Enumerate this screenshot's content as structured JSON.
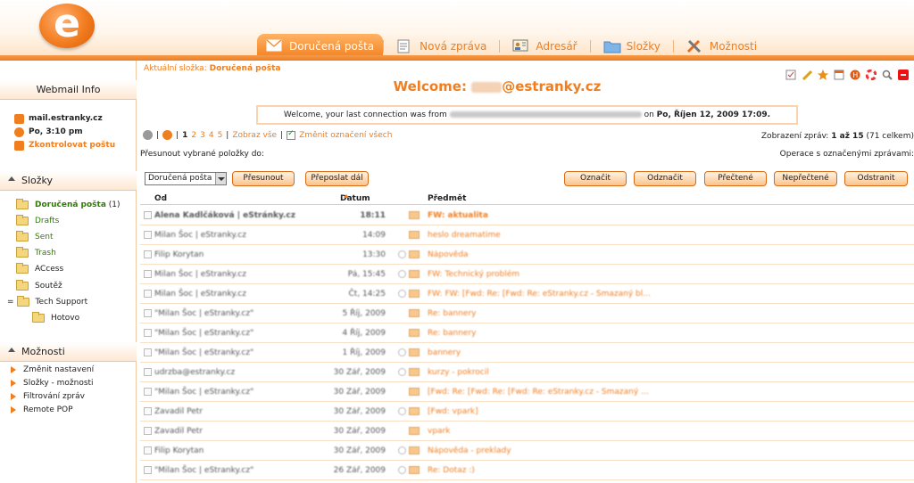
{
  "header": {
    "tabs": [
      {
        "label": "Doručená pošta",
        "icon": "envelope-icon",
        "active": true
      },
      {
        "label": "Nová zpráva",
        "icon": "compose-icon",
        "active": false
      },
      {
        "label": "Adresář",
        "icon": "addressbook-icon",
        "active": false
      },
      {
        "label": "Složky",
        "icon": "folder-icon",
        "active": false
      },
      {
        "label": "Možnosti",
        "icon": "tools-icon",
        "active": false
      }
    ]
  },
  "sidebar": {
    "info_title": "Webmail Info",
    "server": "mail.estranky.cz",
    "datetime": "Po, 3:10 pm",
    "check_mail": "Zkontrolovat poštu",
    "folders_title": "Složky",
    "folders": [
      {
        "label": "Doručená pošta",
        "count": "(1)"
      },
      {
        "label": "Drafts"
      },
      {
        "label": "Sent"
      },
      {
        "label": "Trash"
      },
      {
        "label": "ACcess"
      },
      {
        "label": "Soutěž"
      },
      {
        "label": "Tech Support",
        "toggle": "="
      },
      {
        "label": "Hotovo"
      }
    ],
    "options_title": "Možnosti",
    "options": [
      "Změnit nastavení",
      "Složky - možnosti",
      "Filtrování zpráv",
      "Remote POP"
    ]
  },
  "main": {
    "breadcrumb_label": "Aktuální složka:",
    "breadcrumb_folder": "Doručená pošta",
    "welcome_prefix": "Welcome:",
    "welcome_domain": "@estranky.cz",
    "lastconn_prefix": "Welcome, your last connection was from",
    "lastconn_on": "on",
    "lastconn_date": "Po, Říjen 12, 2009 17:09.",
    "pager_sep": "|",
    "pages": [
      "1",
      "2",
      "3",
      "4",
      "5"
    ],
    "show_all": "Zobraz vše",
    "toggle_all": "Změnit označení všech",
    "show_info_prefix": "Zobrazení zpráv:",
    "show_info_range": "1 až 15",
    "show_info_total": "(71 celkem)",
    "move_label": "Přesunout vybrané položky do:",
    "ops_label": "Operace s označenými zprávami:",
    "select_value": "Doručená pošta",
    "buttons": {
      "move": "Přesunout",
      "forward": "Přeposlat dál",
      "mark": "Označit",
      "unmark": "Odznačit",
      "read": "Přečtené",
      "unread": "Nepřečtené",
      "delete": "Odstranit"
    },
    "columns": {
      "from": "Od",
      "date": "Datum",
      "subject": "Předmět"
    },
    "rows": [
      {
        "from": "Alena Kadlčáková | eStránky.cz",
        "date": "18:11",
        "subject": "FW: aktualita",
        "bold": true,
        "attach": false
      },
      {
        "from": "Milan Šoc | eStranky.cz",
        "date": "14:09",
        "subject": "heslo dreamatime",
        "bold": false,
        "attach": false
      },
      {
        "from": "Filip Korytan",
        "date": "13:30",
        "subject": "Nápověda",
        "bold": false,
        "attach": true
      },
      {
        "from": "Milan Šoc | eStranky.cz",
        "date": "Pá, 15:45",
        "subject": "FW: Technický problém",
        "bold": false,
        "attach": true
      },
      {
        "from": "Milan Šoc | eStranky.cz",
        "date": "Čt, 14:25",
        "subject": "FW: FW: [Fwd: Re: [Fwd: Re: eStranky.cz - Smazaný bl...",
        "bold": false,
        "attach": true
      },
      {
        "from": "\"Milan Šoc | eStranky.cz\"",
        "date": "5 Říj, 2009",
        "subject": "Re: bannery",
        "bold": false,
        "attach": false
      },
      {
        "from": "\"Milan Šoc | eStranky.cz\"",
        "date": "4 Říj, 2009",
        "subject": "Re: bannery",
        "bold": false,
        "attach": false
      },
      {
        "from": "\"Milan Šoc | eStranky.cz\"",
        "date": "1 Říj, 2009",
        "subject": "bannery",
        "bold": false,
        "attach": true
      },
      {
        "from": "udrzba@estranky.cz",
        "date": "30 Zář, 2009",
        "subject": "kurzy - pokrocil",
        "bold": false,
        "attach": true
      },
      {
        "from": "\"Milan Šoc | eStranky.cz\"",
        "date": "30 Zář, 2009",
        "subject": "[Fwd: Re: [Fwd: Re: [Fwd: Re: eStranky.cz - Smazaný ...",
        "bold": false,
        "attach": false
      },
      {
        "from": "Zavadil Petr",
        "date": "30 Zář, 2009",
        "subject": "[Fwd: vpark]",
        "bold": false,
        "attach": true
      },
      {
        "from": "Zavadil Petr",
        "date": "30 Zář, 2009",
        "subject": "vpark",
        "bold": false,
        "attach": false
      },
      {
        "from": "Filip Korytan",
        "date": "30 Zář, 2009",
        "subject": "Nápověda - preklady",
        "bold": false,
        "attach": true
      },
      {
        "from": "\"Milan Šoc | eStranky.cz\"",
        "date": "26 Zář, 2009",
        "subject": "Re: Dotaz :)",
        "bold": false,
        "attach": true
      }
    ]
  }
}
